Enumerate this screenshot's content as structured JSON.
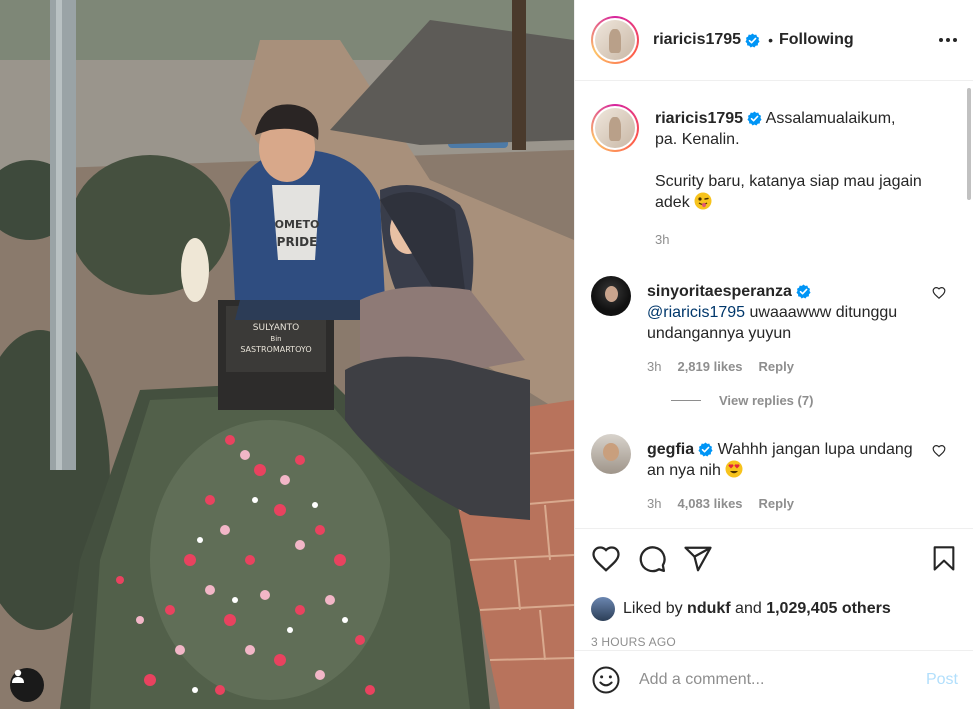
{
  "post": {
    "username": "riaricis1795",
    "follow_status": "Following",
    "separator": "•",
    "caption_line1": "Assalamualaikum, pa. Kenalin.",
    "caption_line2": "Scurity baru, katanya siap mau jagain adek",
    "caption_time": "3h"
  },
  "photo": {
    "tombstone_line1": "SULYANTO",
    "tombstone_line2": "Bin",
    "tombstone_line3": "SASTROMARTOYO",
    "shirt_text_1": "OMETO",
    "shirt_text_2": "PRIDE"
  },
  "comments": [
    {
      "username": "sinyoritaesperanza",
      "mention": "@riaricis1795",
      "text": " uwaaawww ditunggu undangannya yuyun",
      "time": "3h",
      "likes": "2,819 likes",
      "reply": "Reply",
      "view_replies": "View replies (7)"
    },
    {
      "username": "gegfia",
      "text": "Wahhh jangan lupa undang an nya nih",
      "time": "3h",
      "likes": "4,083 likes",
      "reply": "Reply"
    }
  ],
  "liked_by": {
    "prefix": "Liked by",
    "user": "ndukf",
    "and": "and",
    "others": "1,029,405 others"
  },
  "posted_ago": "3 HOURS AGO",
  "comment_input": {
    "placeholder": "Add a comment...",
    "post_label": "Post"
  },
  "colors": {
    "verified": "#0095f6",
    "mention": "#00376b",
    "muted": "#8e8e8e",
    "post_button_disabled": "#b2dffc"
  },
  "icons": [
    "user-tag-icon",
    "verified-icon",
    "more-options-icon",
    "heart-icon",
    "comment-icon",
    "share-icon",
    "bookmark-icon",
    "emoji-icon"
  ]
}
